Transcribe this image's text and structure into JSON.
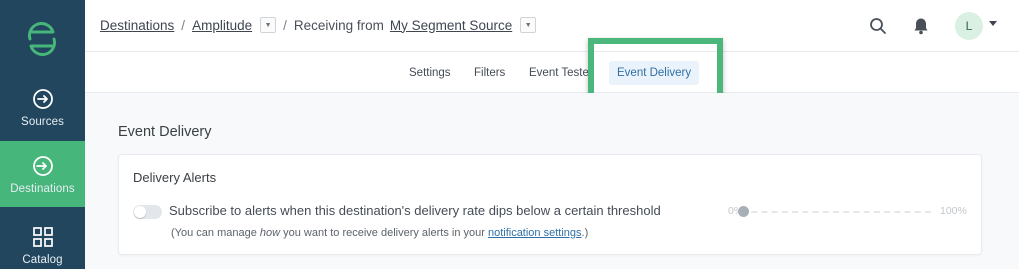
{
  "sidebar": {
    "logo": "segment-logo",
    "items": [
      {
        "label": "Sources",
        "icon": "sources-icon"
      },
      {
        "label": "Destinations",
        "icon": "destinations-icon",
        "active": true
      },
      {
        "label": "Catalog",
        "icon": "catalog-icon"
      }
    ]
  },
  "header": {
    "breadcrumb": {
      "root": "Destinations",
      "separator": "/",
      "destination": "Amplitude",
      "receiving_prefix": "Receiving from",
      "source": "My Segment Source"
    },
    "avatar_initial": "L"
  },
  "tabs": [
    {
      "label": "Settings"
    },
    {
      "label": "Filters"
    },
    {
      "label": "Event Tester"
    },
    {
      "label": "Event Delivery",
      "active": true
    }
  ],
  "main": {
    "section_title": "Event Delivery",
    "card": {
      "title": "Delivery Alerts",
      "subscribe_text": "Subscribe to alerts when this destination's delivery rate dips below a certain threshold",
      "toggle_on": false,
      "help": {
        "prefix": "(You can manage ",
        "emphasis": "how",
        "middle": " you want to receive delivery alerts in your ",
        "link": "notification settings",
        "suffix": ".)"
      },
      "slider": {
        "min_label": "0%",
        "max_label": "100%",
        "value": 0
      }
    }
  },
  "colors": {
    "sidebar_bg": "#22465e",
    "active_nav": "#46b67a",
    "highlight": "#4bb77c",
    "link": "#2f6fa6"
  }
}
